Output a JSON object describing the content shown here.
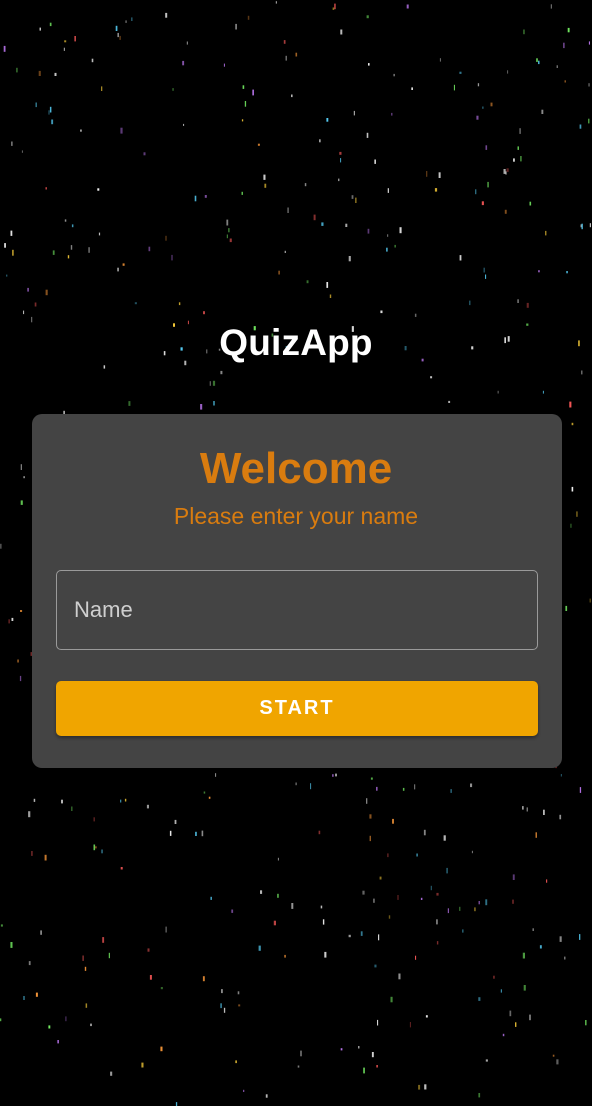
{
  "app": {
    "title": "QuizApp"
  },
  "card": {
    "heading": "Welcome",
    "subtitle": "Please enter your name",
    "name_input": {
      "value": "",
      "placeholder": "Name"
    },
    "start_button_label": "START"
  },
  "colors": {
    "background": "#000000",
    "card_background": "#444444",
    "accent_text": "#d97c0f",
    "button": "#f0a500",
    "title_text": "#ffffff"
  }
}
